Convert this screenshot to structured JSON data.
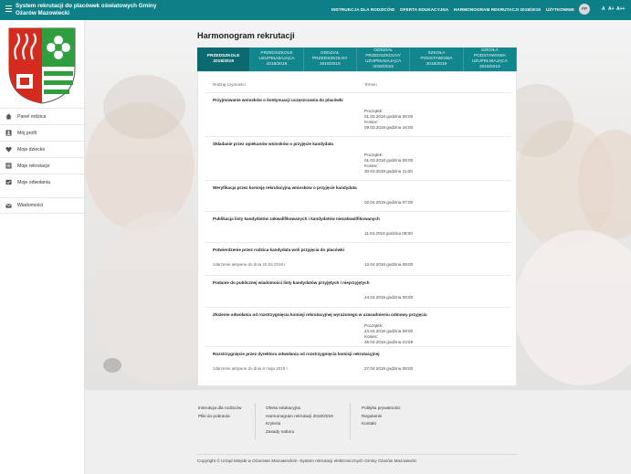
{
  "header": {
    "title": "System rekrutacji do placówek oświatowych Gminy Ożarów Mazowiecki",
    "nav": [
      "INSTRUKCJA DLA RODZICÓW",
      "OFERTA EDUKACYJNA",
      "HARMONOGRAM REKRUTACJI 2018/2019"
    ],
    "user_label": "UŻYTKOWNIK",
    "avatar_initials": "PP",
    "font_controls": [
      "A",
      "A+",
      "A++"
    ]
  },
  "sidebar": {
    "items": [
      {
        "label": "Panel rodzica",
        "icon": "home-icon"
      },
      {
        "label": "Mój profil",
        "icon": "profile-icon"
      },
      {
        "label": "Moje dziecko",
        "icon": "heart-icon"
      },
      {
        "label": "Moje rekrutacje",
        "icon": "list-icon"
      },
      {
        "label": "Moje odwołania",
        "icon": "appeal-icon"
      },
      {
        "label": "Wiadomości",
        "icon": "messages-icon"
      }
    ]
  },
  "main": {
    "title": "Harmonogram rekrutacji",
    "tabs": [
      {
        "label": "PRZEDSZKOLE 2018/2019",
        "active": true
      },
      {
        "label": "PRZEDSZKOLE UZUPEŁNIAJĄCA 2018/2019",
        "active": false
      },
      {
        "label": "ODDZIAŁ PRZEDSZKOLNY 2018/2019",
        "active": false
      },
      {
        "label": "ODDZIAŁ PRZEDSZKOLNY UZUPEŁNIAJĄCA 2018/2019",
        "active": false
      },
      {
        "label": "SZKOŁA PODSTAWOWA 2018/2019",
        "active": false
      },
      {
        "label": "SZKOŁA PODSTAWOWA UZUPEŁNIAJĄCA 2018/2019",
        "active": false
      }
    ],
    "col_activity": "Rodzaj czynności",
    "col_term": "Termin",
    "rows": [
      {
        "name": "Przyjmowanie wniosków o kontynuacji uczęszczania do placówki",
        "note": "",
        "dates": [
          "Początek:",
          "01.03.2018 godzina 08:00",
          "Koniec:",
          "09.03.2018 godzina 16:00"
        ]
      },
      {
        "name": "Składanie przez opiekunów wniosków o przyjęcie kandydata",
        "note": "",
        "dates": [
          "Początek:",
          "01.03.2018 godzina 08:00",
          "Koniec:",
          "30.03.2018 godzina 11:00"
        ]
      },
      {
        "name": "Weryfikacja przez komisję rekrutacyjną wniosków o przyjęcie kandydata",
        "note": "",
        "dates": [
          "02.04.2018 godzina 07:00"
        ]
      },
      {
        "name": "Publikacja listy kandydatów zakwalifikowanych i kandydatów niezakwalifikowanych",
        "note": "",
        "dates": [
          "11.04.2018 godzina 08:00"
        ]
      },
      {
        "name": "Potwierdzenie przez rodzica kandydata woli przyjęcia do placówki",
        "note": "zdarzenie aktywne do dnia 20.04.2018 r.",
        "dates": [
          "12.04.2018 godzina 08:00"
        ]
      },
      {
        "name": "Podanie do publicznej wiadomości listy kandydatów przyjętych i nieprzyjętych",
        "note": "",
        "dates": [
          "24.04.2018 godzina 08:00"
        ]
      },
      {
        "name": "Złożenie odwołania od rozstrzygnięcia komisji rekrutacyjnej wyrażonego w uzasadnieniu odmowy przyjęcia",
        "note": "",
        "dates": [
          "Początek:",
          "24.04.2018 godzina 08:00",
          "Koniec:",
          "26.04.2018 godzina 23:59"
        ]
      },
      {
        "name": "Rozstrzygnięcie przez dyrektora odwołania od rozstrzygnięcia komisji rekrutacyjnej",
        "note": "zdarzenie aktywne do dnia 6 maja 2018 r.",
        "dates": [
          "27.04.2018 godzina 08:00"
        ]
      }
    ]
  },
  "footer": {
    "col1": [
      "Instrukcja dla rodziców",
      "Pliki do pobrania"
    ],
    "col2": [
      "Oferta edukacyjna",
      "Harmonogram rekrutacji 2018/2019",
      "Kryteria",
      "Zasady naboru"
    ],
    "col3": [
      "Polityka prywatności",
      "Regulamin",
      "Kontakt"
    ],
    "copyright": "Copyright © Urząd Miejski w Ożarowie Mazowieckim -System rekrutacji elektronicznych Gminy Ożarów Mazowiecki"
  },
  "colors": {
    "brand": "#0e7f86",
    "tab_active": "#0a6a70",
    "crest_red": "#d52b1e",
    "crest_green": "#2e9e3e"
  }
}
